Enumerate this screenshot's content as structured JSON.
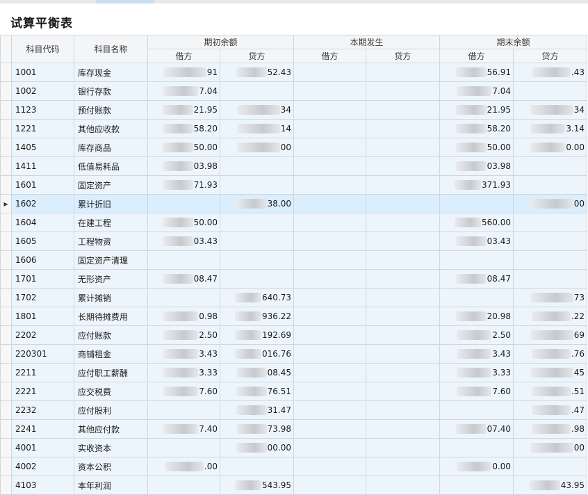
{
  "page": {
    "title": "试算平衡表"
  },
  "headers": {
    "code": "科目代码",
    "name": "科目名称",
    "opening": "期初余额",
    "current": "本期发生",
    "closing": "期末余额",
    "debit": "借方",
    "credit": "贷方"
  },
  "rows": [
    {
      "code": "1001",
      "name": "库存现金",
      "od": "91",
      "oc": "52.43",
      "cd": "",
      "cc": "",
      "ed": "56.91",
      "ec": ".43"
    },
    {
      "code": "1002",
      "name": "银行存款",
      "od": "7.04",
      "oc": "",
      "cd": "",
      "cc": "",
      "ed": "7.04",
      "ec": ""
    },
    {
      "code": "1123",
      "name": "预付账款",
      "od": "21.95",
      "oc": "34",
      "cd": "",
      "cc": "",
      "ed": "21.95",
      "ec": "34"
    },
    {
      "code": "1221",
      "name": "其他应收款",
      "od": "58.20",
      "oc": "14",
      "cd": "",
      "cc": "",
      "ed": "58.20",
      "ec": "3.14"
    },
    {
      "code": "1405",
      "name": "库存商品",
      "od": "50.00",
      "oc": "00",
      "cd": "",
      "cc": "",
      "ed": "50.00",
      "ec": "0.00"
    },
    {
      "code": "1411",
      "name": "低值易耗品",
      "od": "03.98",
      "oc": "",
      "cd": "",
      "cc": "",
      "ed": "03.98",
      "ec": ""
    },
    {
      "code": "1601",
      "name": "固定资产",
      "od": "71.93",
      "oc": "",
      "cd": "",
      "cc": "",
      "ed": "371.93",
      "ec": ""
    },
    {
      "code": "1602",
      "name": "累计折旧",
      "od": "",
      "oc": "38.00",
      "cd": "",
      "cc": "",
      "ed": "",
      "ec": "00"
    },
    {
      "code": "1604",
      "name": "在建工程",
      "od": "50.00",
      "oc": "",
      "cd": "",
      "cc": "",
      "ed": "560.00",
      "ec": ""
    },
    {
      "code": "1605",
      "name": "工程物资",
      "od": "03.43",
      "oc": "",
      "cd": "",
      "cc": "",
      "ed": "03.43",
      "ec": ""
    },
    {
      "code": "1606",
      "name": "固定资产清理",
      "od": "",
      "oc": "",
      "cd": "",
      "cc": "",
      "ed": "",
      "ec": ""
    },
    {
      "code": "1701",
      "name": "无形资产",
      "od": "08.47",
      "oc": "",
      "cd": "",
      "cc": "",
      "ed": "08.47",
      "ec": ""
    },
    {
      "code": "1702",
      "name": "累计摊销",
      "od": "",
      "oc": "640.73",
      "cd": "",
      "cc": "",
      "ed": "",
      "ec": "73"
    },
    {
      "code": "1801",
      "name": "长期待摊费用",
      "od": "0.98",
      "oc": "936.22",
      "cd": "",
      "cc": "",
      "ed": "20.98",
      "ec": ".22"
    },
    {
      "code": "2202",
      "name": "应付账款",
      "od": "2.50",
      "oc": "192.69",
      "cd": "",
      "cc": "",
      "ed": "2.50",
      "ec": "69"
    },
    {
      "code": "220301",
      "name": "商铺租金",
      "od": "3.43",
      "oc": "016.76",
      "cd": "",
      "cc": "",
      "ed": "3.43",
      "ec": ".76"
    },
    {
      "code": "2211",
      "name": "应付职工薪酬",
      "od": "3.33",
      "oc": "08.45",
      "cd": "",
      "cc": "",
      "ed": "3.33",
      "ec": "45"
    },
    {
      "code": "2221",
      "name": "应交税费",
      "od": "7.60",
      "oc": "76.51",
      "cd": "",
      "cc": "",
      "ed": "7.60",
      "ec": ".51"
    },
    {
      "code": "2232",
      "name": "应付股利",
      "od": "",
      "oc": "31.47",
      "cd": "",
      "cc": "",
      "ed": "",
      "ec": ".47"
    },
    {
      "code": "2241",
      "name": "其他应付款",
      "od": "7.40",
      "oc": "73.98",
      "cd": "",
      "cc": "",
      "ed": "07.40",
      "ec": ".98"
    },
    {
      "code": "4001",
      "name": "实收资本",
      "od": "",
      "oc": "00.00",
      "cd": "",
      "cc": "",
      "ed": "",
      "ec": "00"
    },
    {
      "code": "4002",
      "name": "资本公积",
      "od": ".00",
      "oc": "",
      "cd": "",
      "cc": "",
      "ed": "0.00",
      "ec": ""
    },
    {
      "code": "4103",
      "name": "本年利润",
      "od": "",
      "oc": "543.95",
      "cd": "",
      "cc": "",
      "ed": "",
      "ec": "43.95"
    }
  ],
  "selected_row": 7
}
